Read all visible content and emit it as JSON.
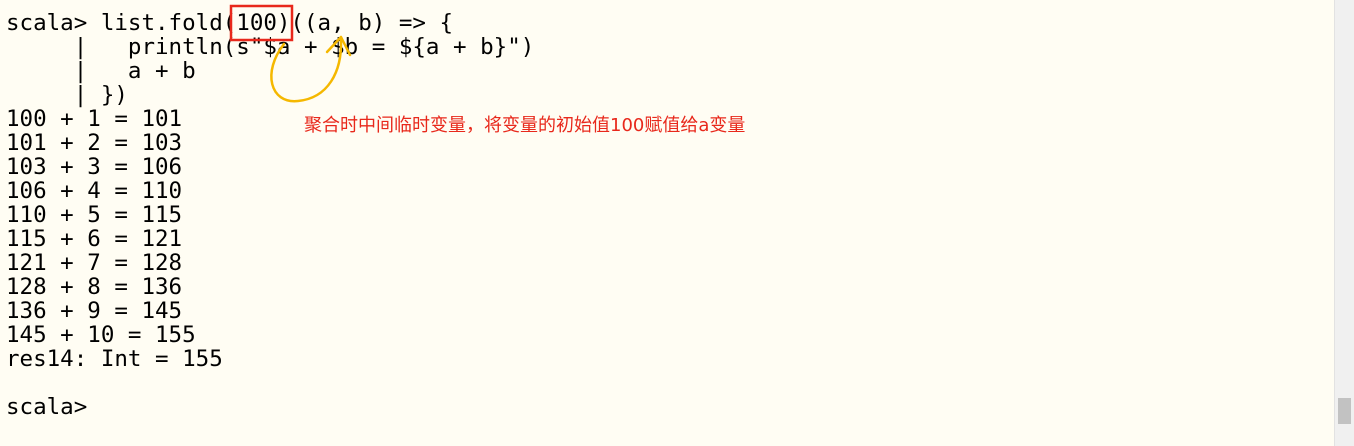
{
  "terminal": {
    "lines": [
      "scala> list.fold(100)((a, b) => {",
      "     |   println(s\"$a + $b = ${a + b}\")",
      "     |   a + b",
      "     | })",
      "100 + 1 = 101",
      "101 + 2 = 103",
      "103 + 3 = 106",
      "106 + 4 = 110",
      "110 + 5 = 115",
      "115 + 6 = 121",
      "121 + 7 = 128",
      "128 + 8 = 136",
      "136 + 9 = 145",
      "145 + 10 = 155",
      "res14: Int = 155",
      "",
      "scala>"
    ]
  },
  "annotation": {
    "text": "聚合时中间临时变量，将变量的初始值100赋值给a变量"
  },
  "colors": {
    "background": "#fffdf3",
    "text": "#000000",
    "annotation_text": "#e8281b",
    "highlight_box": "#e8281b",
    "arrow": "#f5b800"
  }
}
